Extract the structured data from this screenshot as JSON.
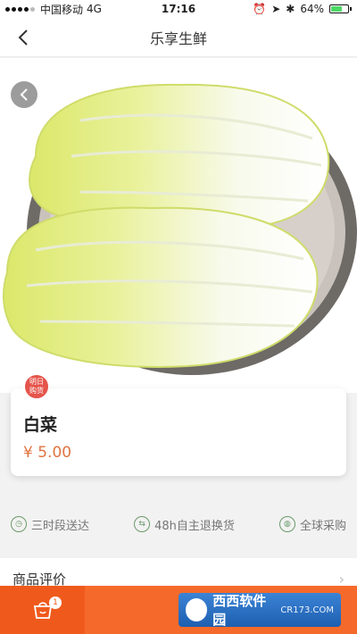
{
  "status_bar": {
    "carrier": "中国移动",
    "network": "4G",
    "time": "17:16",
    "battery": "64%",
    "battery_level": 0.64
  },
  "nav": {
    "title": "乐享生鲜"
  },
  "product": {
    "name": "白菜",
    "price": "¥ 5.00",
    "badge": "明日\n购货"
  },
  "services": [
    {
      "label": "三时段送达",
      "icon": "clock-icon"
    },
    {
      "label": "48h自主退换货",
      "icon": "return-icon"
    },
    {
      "label": "全球采购",
      "icon": "globe-icon"
    }
  ],
  "reviews": {
    "title": "商品评价"
  },
  "bottom_bar": {
    "cart_count": "1",
    "watermark_title": "西西软件园",
    "watermark_sub": "CR173.COM"
  },
  "colors": {
    "accent": "#f56a2a",
    "price": "#e0733f",
    "badge": "#e5544a"
  }
}
